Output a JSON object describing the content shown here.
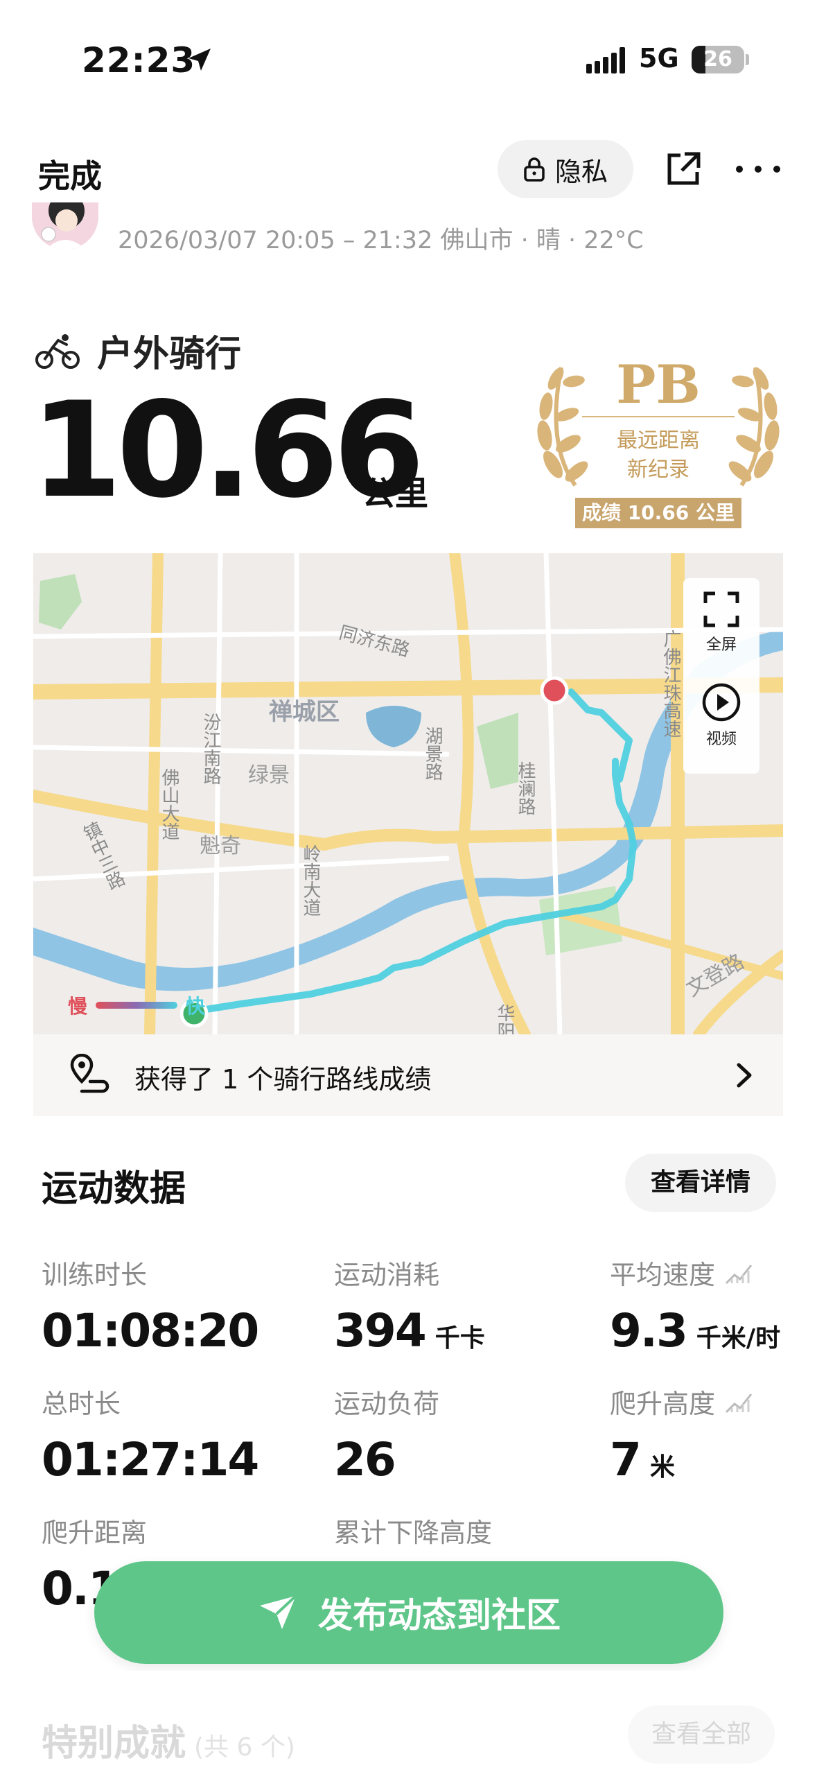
{
  "status_bar": {
    "time": "22:23",
    "network": "5G",
    "battery": "26",
    "battery_level": 0.26
  },
  "header": {
    "done_label": "完成",
    "privacy_label": "隐私"
  },
  "activity": {
    "meta": "2026/03/07 20:05 – 21:32 佛山市 · 晴 · 22°C",
    "type_label": "户外骑行",
    "distance": "10.66",
    "distance_unit": "公里"
  },
  "pb_badge": {
    "title": "PB",
    "line1": "最远距离",
    "line2": "新纪录",
    "score": "成绩 10.66 公里"
  },
  "map": {
    "labels": {
      "tongji_road": "同济东路",
      "chancheng": "禅城区",
      "fenjiang": "汾江南路",
      "lvjing": "绿景",
      "hujing": "湖景路",
      "guilan": "桂澜路",
      "foshan_ave": "佛山大道",
      "kuiqi": "魁奇",
      "zhenzhong": "镇中三路",
      "lingnan": "岭南大道",
      "guangfo": "广佛江珠高速",
      "wendeng": "文登路",
      "huayang": "华阳"
    },
    "fullscreen_label": "全屏",
    "video_label": "视频",
    "legend_slow": "慢",
    "legend_fast": "快"
  },
  "achievement": {
    "text": "获得了 1 个骑行路线成绩"
  },
  "stats": {
    "title": "运动数据",
    "detail_label": "查看详情",
    "items": [
      {
        "label": "训练时长",
        "value": "01:08:20",
        "unit": ""
      },
      {
        "label": "运动消耗",
        "value": "394",
        "unit": "千卡"
      },
      {
        "label": "平均速度",
        "value": "9.3",
        "unit": "千米/时"
      },
      {
        "label": "总时长",
        "value": "01:27:14",
        "unit": ""
      },
      {
        "label": "运动负荷",
        "value": "26",
        "unit": ""
      },
      {
        "label": "爬升高度",
        "value": "7",
        "unit": "米"
      },
      {
        "label": "爬升距离",
        "value": "0.1",
        "unit": ""
      },
      {
        "label": "累计下降高度",
        "value": "",
        "unit": ""
      }
    ]
  },
  "publish": {
    "label": "发布动态到社区"
  },
  "special": {
    "title": "特别成就",
    "count": "(共 6 个)",
    "view_all": "查看全部"
  },
  "colors": {
    "accent_green": "#5fc68a",
    "route": "#4fd0df",
    "start_marker": "#3fb36a",
    "end_marker": "#e0505a",
    "gold": "#cfaa6a"
  }
}
